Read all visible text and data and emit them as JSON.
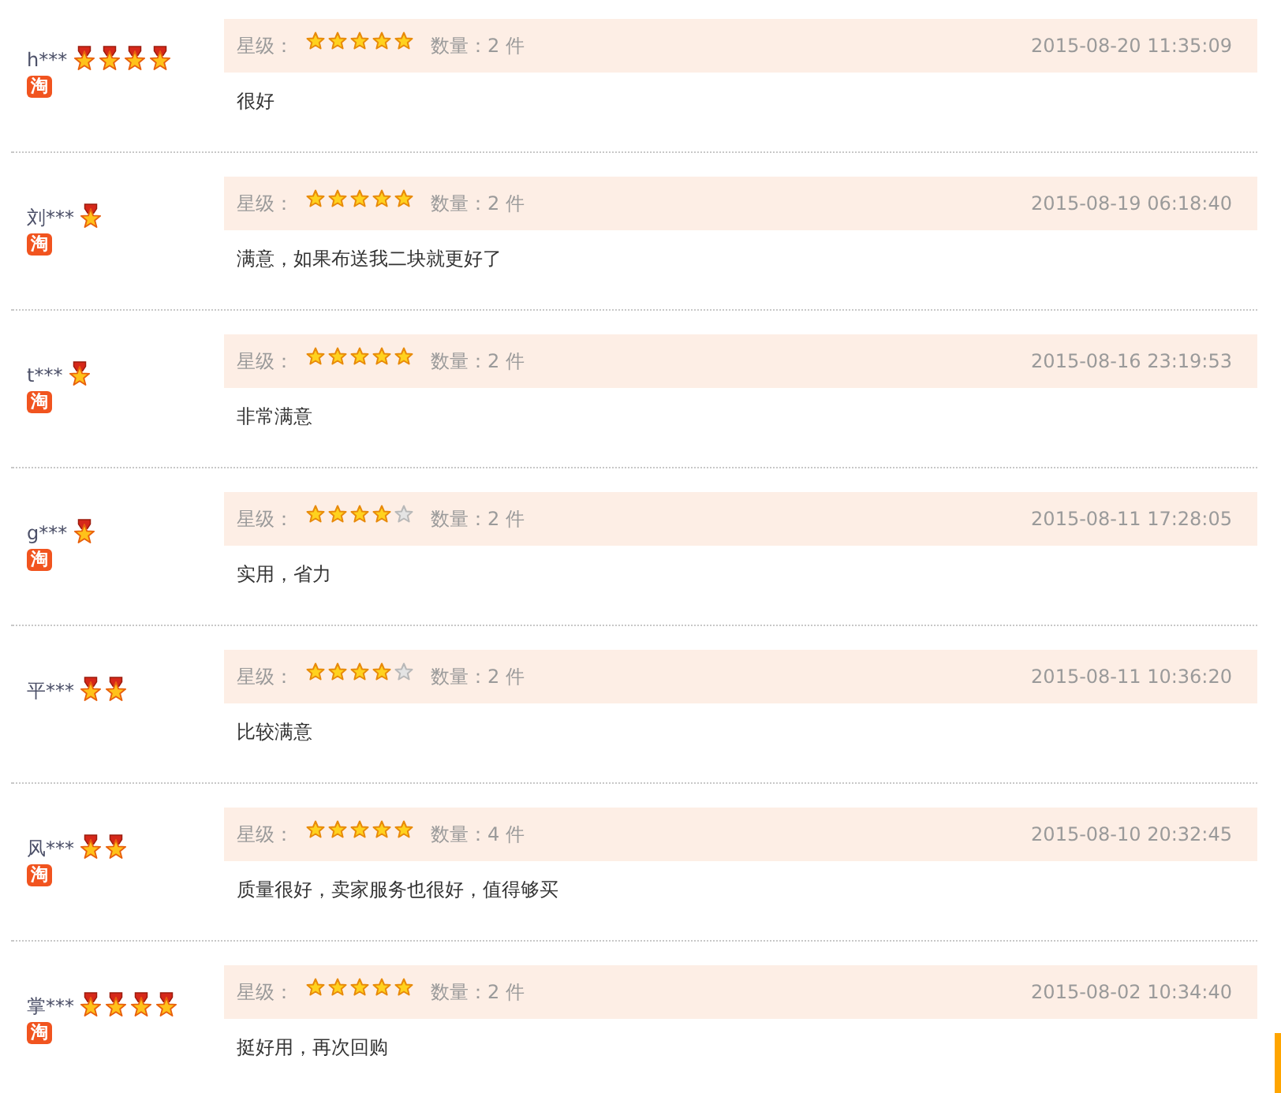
{
  "reviews": [
    {
      "user": {
        "name": "h***",
        "medals": [
          {
            "kind": "star"
          },
          {
            "kind": "star"
          },
          {
            "kind": "star"
          },
          {
            "kind": "star"
          }
        ],
        "badge": "淘"
      },
      "rating": {
        "label": "星级：",
        "stars": 5
      },
      "quantity": "数量：2 件",
      "date": "2015-08-20 11:35:09",
      "comment": "很好"
    },
    {
      "user": {
        "name": "刘***",
        "medals": [
          {
            "kind": "star"
          }
        ],
        "badge": "淘"
      },
      "rating": {
        "label": "星级：",
        "stars": 5
      },
      "quantity": "数量：2 件",
      "date": "2015-08-19 06:18:40",
      "comment": "满意，如果布送我二块就更好了"
    },
    {
      "user": {
        "name": "t***",
        "medals": [
          {
            "kind": "star"
          }
        ],
        "badge": "淘"
      },
      "rating": {
        "label": "星级：",
        "stars": 5
      },
      "quantity": "数量：2 件",
      "date": "2015-08-16 23:19:53",
      "comment": "非常满意"
    },
    {
      "user": {
        "name": "g***",
        "medals": [
          {
            "kind": "star"
          }
        ],
        "badge": "淘"
      },
      "rating": {
        "label": "星级：",
        "stars": 4
      },
      "quantity": "数量：2 件",
      "date": "2015-08-11 17:28:05",
      "comment": "实用，省力"
    },
    {
      "user": {
        "name": "平***",
        "medals": [
          {
            "kind": "star"
          },
          {
            "kind": "star"
          }
        ]
      },
      "rating": {
        "label": "星级：",
        "stars": 4
      },
      "quantity": "数量：2 件",
      "date": "2015-08-11 10:36:20",
      "comment": "比较满意"
    },
    {
      "user": {
        "name": "风***",
        "medals": [
          {
            "kind": "star"
          },
          {
            "kind": "star"
          }
        ],
        "badge": "淘"
      },
      "rating": {
        "label": "星级：",
        "stars": 5
      },
      "quantity": "数量：4 件",
      "date": "2015-08-10 20:32:45",
      "comment": "质量很好，卖家服务也很好，值得够买"
    },
    {
      "user": {
        "name": "掌***",
        "medals": [
          {
            "kind": "star"
          },
          {
            "kind": "star"
          },
          {
            "kind": "star"
          },
          {
            "kind": "star"
          }
        ],
        "badge": "淘"
      },
      "rating": {
        "label": "星级：",
        "stars": 5
      },
      "quantity": "数量：2 件",
      "date": "2015-08-02 10:34:40",
      "comment": "挺好用，再次回购"
    }
  ]
}
